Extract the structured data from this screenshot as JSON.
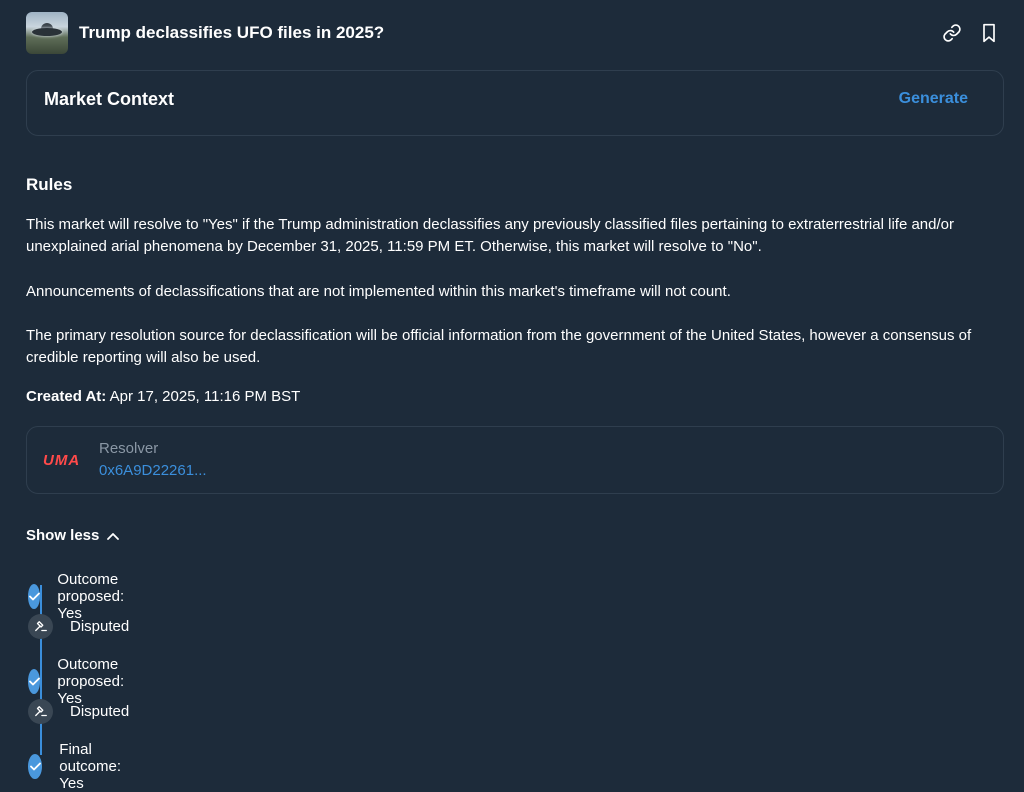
{
  "header": {
    "title": "Trump declassifies UFO files in 2025?",
    "link_icon": "link-icon",
    "bookmark_icon": "bookmark-icon"
  },
  "market_context": {
    "title": "Market Context",
    "generate_label": "Generate"
  },
  "rules": {
    "heading": "Rules",
    "paragraphs": [
      "This market will resolve to \"Yes\" if the Trump administration declassifies any previously classified files pertaining to extraterrestrial life and/or unexplained arial phenomena by December 31, 2025, 11:59 PM ET. Otherwise, this market will resolve to \"No\".",
      "Announcements of declassifications that are not implemented within this market's timeframe will not count.",
      "The primary resolution source for declassification will be official information from the government of the United States, however a consensus of credible reporting will also be used."
    ],
    "created_label": "Created At:",
    "created_value": "Apr 17, 2025, 11:16 PM BST"
  },
  "resolver": {
    "logo_text": "UMA",
    "label": "Resolver",
    "address": "0x6A9D22261..."
  },
  "toggle": {
    "label": "Show less"
  },
  "timeline": [
    {
      "label": "Outcome proposed: Yes",
      "status": "check"
    },
    {
      "label": "Disputed",
      "status": "gavel"
    },
    {
      "label": "Outcome proposed: Yes",
      "status": "check"
    },
    {
      "label": "Disputed",
      "status": "gavel"
    },
    {
      "label": "Final outcome: Yes",
      "status": "check"
    }
  ],
  "colors": {
    "background": "#1d2b3a",
    "accent": "#3b8fdc",
    "uma_red": "#ff4a4a"
  }
}
